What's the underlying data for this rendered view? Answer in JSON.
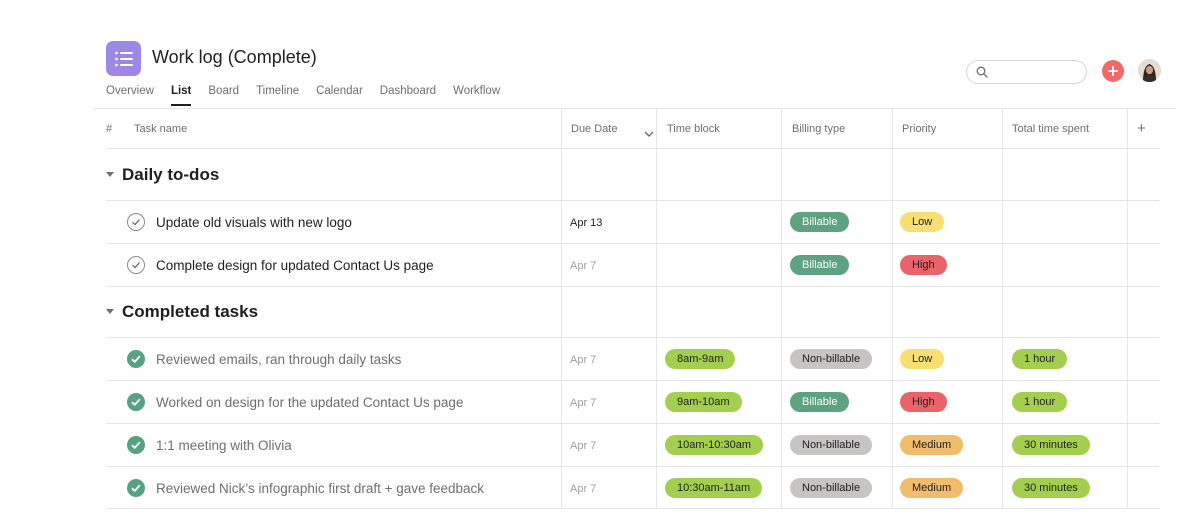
{
  "project": {
    "icon": "list-icon",
    "title": "Work log (Complete)",
    "accent_color": "#9d88e8"
  },
  "tabs": [
    {
      "label": "Overview",
      "active": false
    },
    {
      "label": "List",
      "active": true
    },
    {
      "label": "Board",
      "active": false
    },
    {
      "label": "Timeline",
      "active": false
    },
    {
      "label": "Calendar",
      "active": false
    },
    {
      "label": "Dashboard",
      "active": false
    },
    {
      "label": "Workflow",
      "active": false
    }
  ],
  "search": {
    "placeholder": "",
    "value": ""
  },
  "columns": {
    "number": "#",
    "task_name": "Task name",
    "due_date": "Due Date",
    "time_block": "Time block",
    "billing_type": "Billing type",
    "priority": "Priority",
    "total_time": "Total time spent",
    "add_column": "+"
  },
  "sections": [
    {
      "title": "Daily to-dos",
      "tasks": [
        {
          "name": "Update old visuals with new logo",
          "due": "Apr 13",
          "due_style": "dark",
          "completed": false,
          "time_block": "",
          "billing": "Billable",
          "billing_style": "billable",
          "priority": "Low",
          "priority_style": "low",
          "total": ""
        },
        {
          "name": "Complete design for updated Contact Us page",
          "due": "Apr 7",
          "due_style": "grey",
          "completed": false,
          "time_block": "",
          "billing": "Billable",
          "billing_style": "billable",
          "priority": "High",
          "priority_style": "high",
          "total": ""
        }
      ]
    },
    {
      "title": "Completed tasks",
      "tasks": [
        {
          "name": "Reviewed emails, ran through daily tasks",
          "due": "Apr 7",
          "due_style": "grey",
          "completed": true,
          "time_block": "8am-9am",
          "billing": "Non-billable",
          "billing_style": "nonbillable",
          "priority": "Low",
          "priority_style": "low",
          "total": "1 hour"
        },
        {
          "name": "Worked on design for the updated Contact Us page",
          "due": "Apr 7",
          "due_style": "grey",
          "completed": true,
          "time_block": "9am-10am",
          "billing": "Billable",
          "billing_style": "billable",
          "priority": "High",
          "priority_style": "high",
          "total": "1 hour"
        },
        {
          "name": "1:1 meeting with Olivia",
          "due": "Apr 7",
          "due_style": "grey",
          "completed": true,
          "time_block": "10am-10:30am",
          "billing": "Non-billable",
          "billing_style": "nonbillable",
          "priority": "Medium",
          "priority_style": "medium",
          "total": "30 minutes"
        },
        {
          "name": "Reviewed Nick’s infographic first draft + gave feedback",
          "due": "Apr 7",
          "due_style": "grey",
          "completed": true,
          "time_block": "10:30am-11am",
          "billing": "Non-billable",
          "billing_style": "nonbillable",
          "priority": "Medium",
          "priority_style": "medium",
          "total": "30 minutes"
        }
      ]
    }
  ],
  "colors": {
    "time_pill": "#a4cf4e",
    "billable": "#5da283",
    "non_billable": "#c7c4c4",
    "low": "#f8df72",
    "high": "#e8636a",
    "medium": "#f1bd6c",
    "completed_check": "#58a182",
    "add_button": "#f06a6a"
  }
}
